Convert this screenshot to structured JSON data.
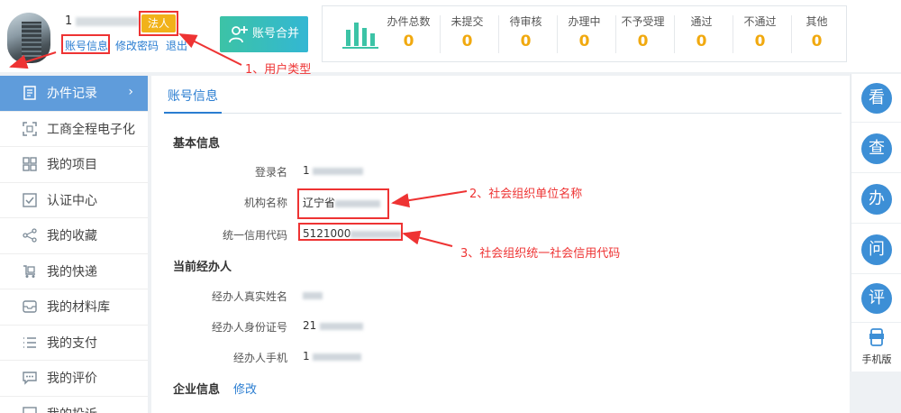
{
  "user": {
    "name_prefix": "1",
    "type_badge": "法人",
    "links": [
      "账号信息",
      "修改密码",
      "退出"
    ]
  },
  "merge_button": "账号合并",
  "stats": [
    {
      "label": "办件总数",
      "value": "0"
    },
    {
      "label": "未提交",
      "value": "0"
    },
    {
      "label": "待审核",
      "value": "0"
    },
    {
      "label": "办理中",
      "value": "0"
    },
    {
      "label": "不予受理",
      "value": "0"
    },
    {
      "label": "通过",
      "value": "0"
    },
    {
      "label": "不通过",
      "value": "0"
    },
    {
      "label": "其他",
      "value": "0"
    }
  ],
  "annotations": {
    "a1": "1、用户类型",
    "a2": "2、社会组织单位名称",
    "a3": "3、社会组织统一社会信用代码"
  },
  "sidebar": {
    "items": [
      {
        "label": "办件记录",
        "icon": "document-icon"
      },
      {
        "label": "工商全程电子化",
        "icon": "scan-icon"
      },
      {
        "label": "我的项目",
        "icon": "project-icon"
      },
      {
        "label": "认证中心",
        "icon": "certificate-icon"
      },
      {
        "label": "我的收藏",
        "icon": "share-icon"
      },
      {
        "label": "我的快递",
        "icon": "delivery-icon"
      },
      {
        "label": "我的材料库",
        "icon": "folder-icon"
      },
      {
        "label": "我的支付",
        "icon": "list-icon"
      },
      {
        "label": "我的评价",
        "icon": "comment-icon"
      },
      {
        "label": "我的投诉",
        "icon": "complaint-icon"
      }
    ]
  },
  "main": {
    "tab": "账号信息",
    "basic_title": "基本信息",
    "fields": {
      "login_label": "登录名",
      "login_prefix": "1",
      "org_label": "机构名称",
      "org_prefix": "辽宁省",
      "credit_label": "统一信用代码",
      "credit_prefix": "5121000"
    },
    "agent_title": "当前经办人",
    "agent": {
      "name_label": "经办人真实姓名",
      "id_label": "经办人身份证号",
      "id_prefix": "21",
      "phone_label": "经办人手机",
      "phone_prefix": "1"
    },
    "enterprise_title": "企业信息",
    "edit_link": "修改"
  },
  "float_bar": {
    "buttons": [
      "看",
      "查",
      "办",
      "问",
      "评"
    ],
    "mobile_label": "手机版"
  },
  "colors": {
    "accent": "#2a7dd1",
    "sidebar_active": "#5f9cdb",
    "stat_value": "#f1a90f",
    "annotation": "#ee3333"
  }
}
